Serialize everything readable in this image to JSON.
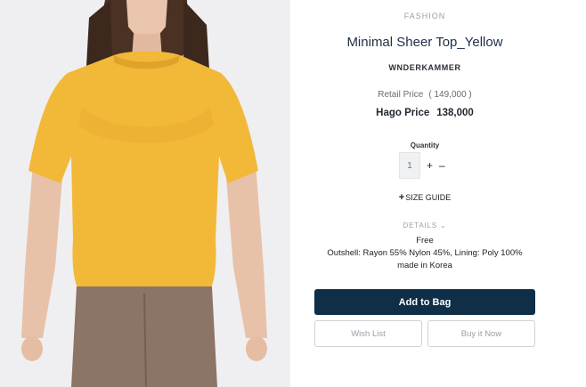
{
  "product": {
    "category": "FASHION",
    "title": "Minimal Sheer Top_Yellow",
    "brand": "WNDERKAMMER",
    "retail_label": "Retail Price",
    "retail_value": "( 149,000 )",
    "price_label": "Hago Price",
    "price_value": "138,000",
    "image_icon": "model-photo-yellow-top"
  },
  "quantity": {
    "label": "Quantity",
    "value": "1",
    "increment": "+",
    "decrement": "–"
  },
  "size_guide": {
    "plus": "+",
    "label": "SIZE GUIDE"
  },
  "details": {
    "label": "DETAILS",
    "chevron": "⌄",
    "lines": [
      "Free",
      "Outshell: Rayon 55% Nylon 45%, Lining: Poly 100%",
      "made in Korea"
    ]
  },
  "actions": {
    "add_to_bag": "Add to Bag",
    "wish_list": "Wish List",
    "buy_now": "Buy it Now"
  },
  "colors": {
    "primary_button": "#0e2f47",
    "title": "#1f2f45",
    "muted": "#9a9ea5"
  }
}
